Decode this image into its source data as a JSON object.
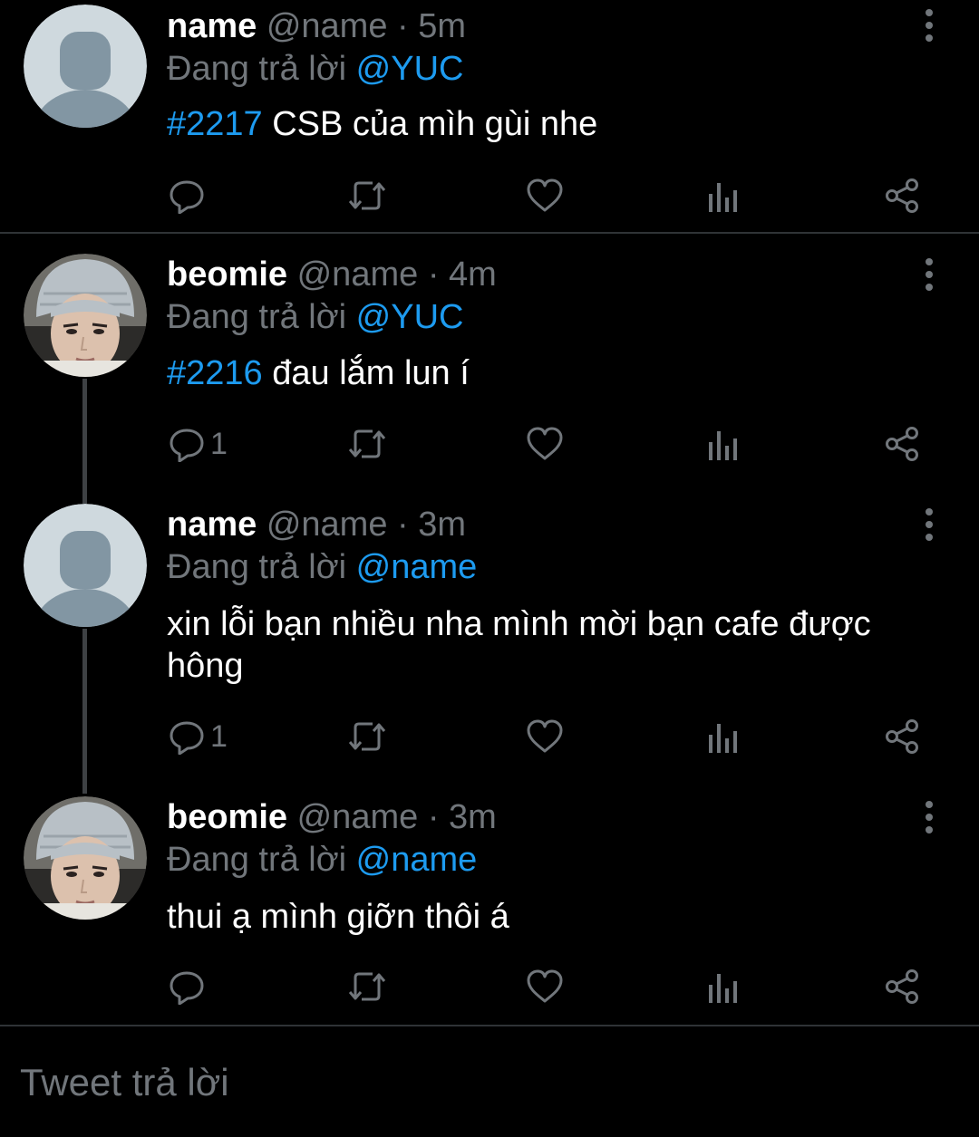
{
  "tweets": [
    {
      "display_name": "name",
      "handle": "@name",
      "separator": "·",
      "time": "5m",
      "reply_prefix": "Đang trả lời",
      "reply_to": "@YUC",
      "hashtag": "#2217",
      "text": " CSB của mìh gùi nhe",
      "reply_count": "",
      "avatar": "default-avatar"
    },
    {
      "display_name": "beomie",
      "handle": "@name",
      "separator": "·",
      "time": "4m",
      "reply_prefix": "Đang trả lời",
      "reply_to": "@YUC",
      "hashtag": "#2216",
      "text": " đau lắm lun í",
      "reply_count": "1",
      "avatar": "photo-avatar"
    },
    {
      "display_name": "name",
      "handle": "@name",
      "separator": "·",
      "time": "3m",
      "reply_prefix": "Đang trả lời",
      "reply_to": "@name",
      "hashtag": "",
      "text": "xin lỗi bạn nhiều nha mình mời bạn cafe được hông",
      "reply_count": "1",
      "avatar": "default-avatar"
    },
    {
      "display_name": "beomie",
      "handle": "@name",
      "separator": "·",
      "time": "3m",
      "reply_prefix": "Đang trả lời",
      "reply_to": "@name",
      "hashtag": "",
      "text": "thui ạ mình giỡn thôi á",
      "reply_count": "",
      "avatar": "photo-avatar"
    }
  ],
  "actions": [
    "reply-icon",
    "retweet-icon",
    "like-icon",
    "analytics-icon",
    "share-icon"
  ],
  "reply_bar": {
    "placeholder": "Tweet trả lời"
  },
  "colors": {
    "background": "#000000",
    "accent": "#1d9bf0",
    "muted": "#71767b",
    "text": "#ffffff",
    "divider": "#2f3336"
  }
}
